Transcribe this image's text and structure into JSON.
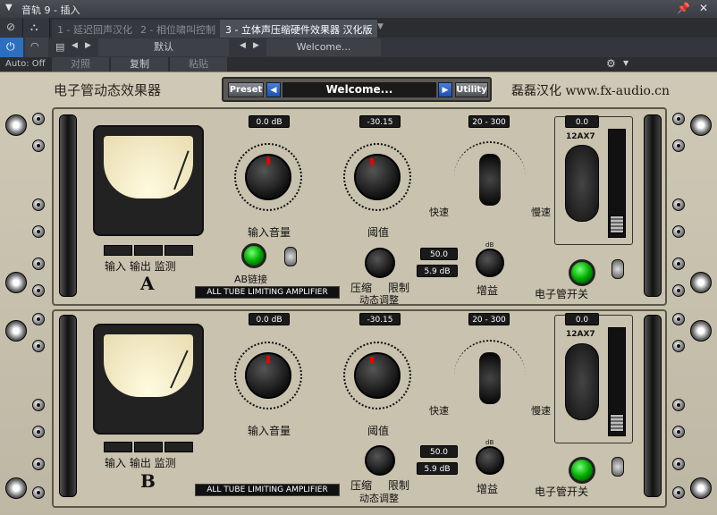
{
  "host": {
    "track_title": "音轨 9 - 插入",
    "tabs": [
      "1 - 延迟回声汉化",
      "2 - 相位啸叫控制",
      "3 - 立体声压缩硬件效果器 汉化版"
    ],
    "preset_default": "默认",
    "preset_welcome": "Welcome...",
    "auto_label": "Auto: Off",
    "compare_label": "对照",
    "copy_label": "复制",
    "paste_label": "粘贴"
  },
  "plugin": {
    "title": "电子管动态效果器",
    "credit": "磊磊汉化 www.fx-audio.cn",
    "preset_button": "Preset",
    "preset_name": "Welcome...",
    "utility_button": "Utility"
  },
  "channels": [
    {
      "letter": "A",
      "input_gain": "0.0 dB",
      "threshold": "-30.15",
      "speed_range": "20 - 300",
      "tube_value": "0.0",
      "tube_type": "12AX7",
      "ratio": "50.0",
      "gain": "5.9 dB",
      "labels": {
        "meter_buttons": "输入 输出 监测",
        "input_volume": "输入音量",
        "threshold": "阈值",
        "fast": "快速",
        "slow": "慢速",
        "ab_link": "AB链接",
        "compress": "压缩",
        "limit": "限制",
        "dynamics": "动态调整",
        "gain": "增益",
        "gain_db": "dB",
        "tube_switch": "电子管开关",
        "strip": "ALL TUBE LIMITING AMPLIFIER"
      }
    },
    {
      "letter": "B",
      "input_gain": "0.0 dB",
      "threshold": "-30.15",
      "speed_range": "20 - 300",
      "tube_value": "0.0",
      "tube_type": "12AX7",
      "ratio": "50.0",
      "gain": "5.9 dB",
      "labels": {
        "meter_buttons": "输入 输出 监测",
        "input_volume": "输入音量",
        "threshold": "阈值",
        "fast": "快速",
        "slow": "慢速",
        "compress": "压缩",
        "limit": "限制",
        "dynamics": "动态调整",
        "gain": "增益",
        "gain_db": "dB",
        "tube_switch": "电子管开关",
        "strip": "ALL TUBE LIMITING AMPLIFIER"
      }
    }
  ],
  "colors": {
    "accent_blue": "#2a5fd0",
    "led_green": "#1cc41c"
  }
}
